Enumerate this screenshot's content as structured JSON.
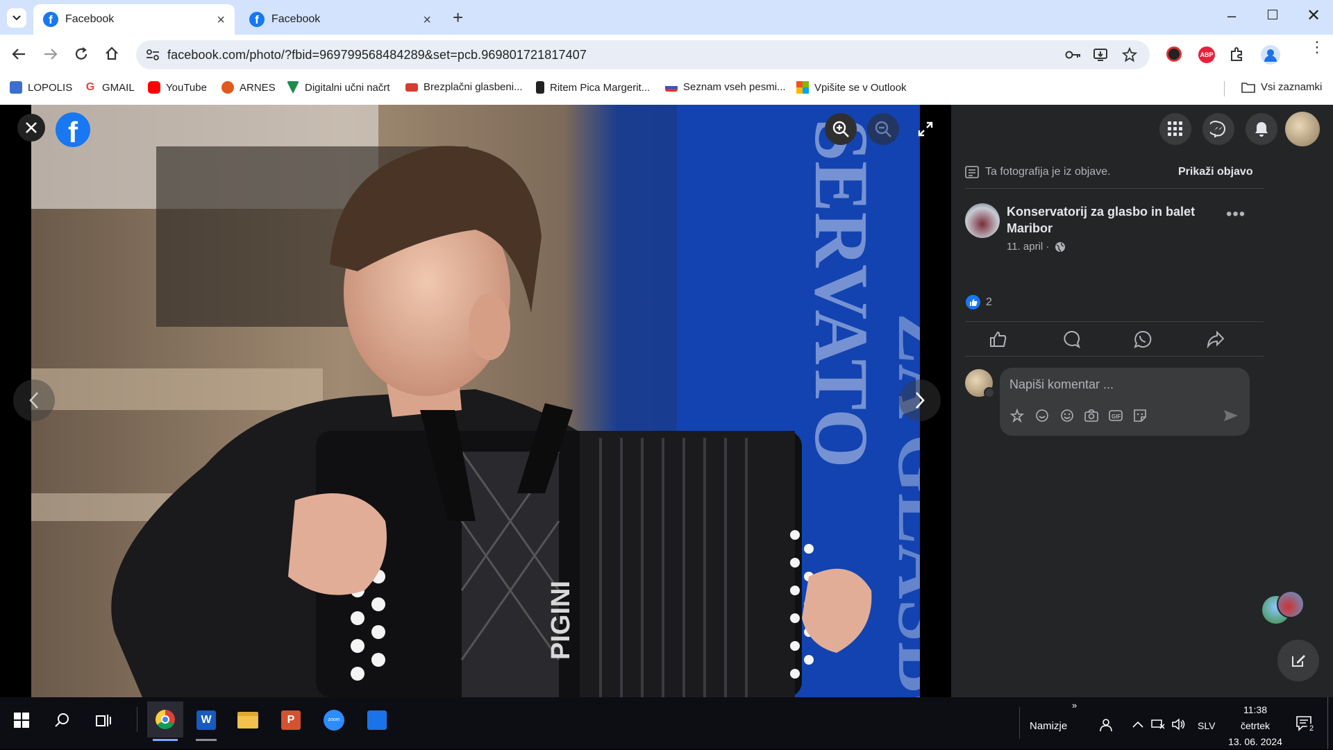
{
  "browser": {
    "tabs": [
      {
        "title": "Facebook",
        "active": true
      },
      {
        "title": "Facebook",
        "active": false
      }
    ],
    "url": "facebook.com/photo/?fbid=969799568484289&set=pcb.969801721817407",
    "bookmarks": [
      {
        "label": "LOPOLIS",
        "icon": "lopolis-icon",
        "color": "#3b6fd1"
      },
      {
        "label": "GMAIL",
        "icon": "google-icon",
        "color": "#ea4335"
      },
      {
        "label": "YouTube",
        "icon": "youtube-icon",
        "color": "#ff0000"
      },
      {
        "label": "ARNES",
        "icon": "arnes-icon",
        "color": "#e05a1c"
      },
      {
        "label": "Digitalni učni načrt",
        "icon": "v-icon",
        "color": "#1e8a4c"
      },
      {
        "label": "Brezplačni glasbeni...",
        "icon": "music-icon",
        "color": "#d63b2f"
      },
      {
        "label": "Ritem Pica Margerit...",
        "icon": "doc-icon",
        "color": "#222222"
      },
      {
        "label": "Seznam vseh pesmi...",
        "icon": "flag-icon",
        "color": "#3557c7"
      },
      {
        "label": "Vpišite se v Outlook",
        "icon": "microsoft-icon",
        "color": "#f25022"
      }
    ],
    "all_bookmarks": "Vsi zaznamki"
  },
  "post": {
    "notice": "Ta fotografija je iz objave.",
    "view_post": "Prikaži objavo",
    "page_name": "Konservatorij za glasbo in balet Maribor",
    "date": "11. april ·",
    "likes": "2",
    "comment_placeholder": "Napiši komentar ..."
  },
  "taskbar": {
    "desktop_label": "Namizje",
    "language": "SLV",
    "time": "11:38",
    "day": "četrtek",
    "date": "13. 06. 2024",
    "notifications": "2"
  },
  "colors": {
    "tabbar": "#d3e3fd",
    "facebook_blue": "#1877f2",
    "panel": "#242526"
  }
}
